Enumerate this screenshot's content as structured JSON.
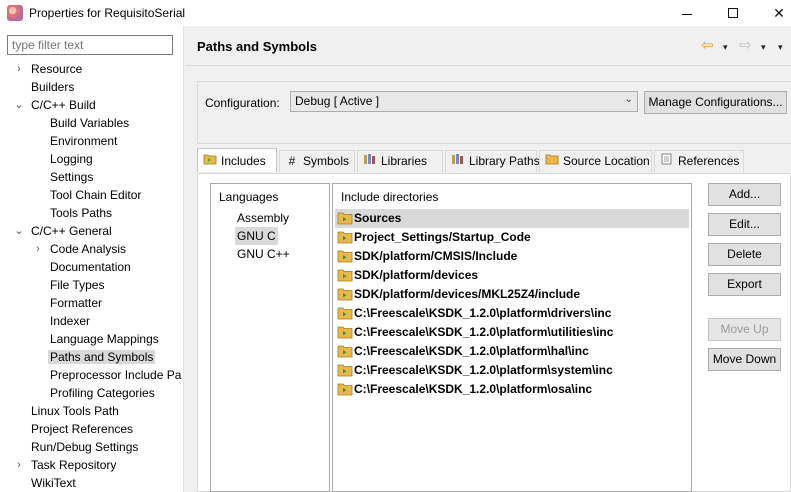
{
  "window": {
    "title": "Properties for RequisitoSerial",
    "minimize_label": "",
    "maximize_label": "",
    "close_label": "✕"
  },
  "filter": {
    "placeholder": "type filter text"
  },
  "tree": [
    {
      "label": "Resource",
      "expander": "›"
    },
    {
      "label": "Builders",
      "expander": ""
    },
    {
      "label": "C/C++ Build",
      "expander": "⌄"
    },
    {
      "label": "Build Variables",
      "expander": ""
    },
    {
      "label": "Environment",
      "expander": ""
    },
    {
      "label": "Logging",
      "expander": ""
    },
    {
      "label": "Settings",
      "expander": ""
    },
    {
      "label": "Tool Chain Editor",
      "expander": ""
    },
    {
      "label": "Tools Paths",
      "expander": ""
    },
    {
      "label": "C/C++ General",
      "expander": "⌄"
    },
    {
      "label": "Code Analysis",
      "expander": "›"
    },
    {
      "label": "Documentation",
      "expander": ""
    },
    {
      "label": "File Types",
      "expander": ""
    },
    {
      "label": "Formatter",
      "expander": ""
    },
    {
      "label": "Indexer",
      "expander": ""
    },
    {
      "label": "Language Mappings",
      "expander": ""
    },
    {
      "label": "Paths and Symbols",
      "expander": ""
    },
    {
      "label": "Preprocessor Include Pa",
      "expander": ""
    },
    {
      "label": "Profiling Categories",
      "expander": ""
    },
    {
      "label": "Linux Tools Path",
      "expander": ""
    },
    {
      "label": "Project References",
      "expander": ""
    },
    {
      "label": "Run/Debug Settings",
      "expander": ""
    },
    {
      "label": "Task Repository",
      "expander": "›"
    },
    {
      "label": "WikiText",
      "expander": ""
    }
  ],
  "page": {
    "title": "Paths and Symbols",
    "back_icon": "⇦",
    "forward_icon": "⇨",
    "dropdown_icon": "▾"
  },
  "configuration": {
    "label": "Configuration:",
    "value": "Debug  [ Active ]",
    "manage_label": "Manage Configurations..."
  },
  "tabs": [
    {
      "label": "Includes",
      "icon": "include-folder-icon"
    },
    {
      "label": "Symbols",
      "icon": "hash-icon"
    },
    {
      "label": "Libraries",
      "icon": "library-icon"
    },
    {
      "label": "Library Paths",
      "icon": "library-path-icon"
    },
    {
      "label": "Source Location",
      "icon": "source-folder-icon"
    },
    {
      "label": "References",
      "icon": "references-icon"
    }
  ],
  "languages": {
    "header": "Languages",
    "items": [
      "Assembly",
      "GNU C",
      "GNU C++"
    ]
  },
  "includes": {
    "header": "Include directories",
    "items": [
      "Sources",
      "Project_Settings/Startup_Code",
      "SDK/platform/CMSIS/Include",
      "SDK/platform/devices",
      "SDK/platform/devices/MKL25Z4/include",
      "C:\\Freescale\\KSDK_1.2.0\\platform\\drivers\\inc",
      "C:\\Freescale\\KSDK_1.2.0\\platform\\utilities\\inc",
      "C:\\Freescale\\KSDK_1.2.0\\platform\\hal\\inc",
      "C:\\Freescale\\KSDK_1.2.0\\platform\\system\\inc",
      "C:\\Freescale\\KSDK_1.2.0\\platform\\osa\\inc"
    ]
  },
  "buttons": {
    "add": "Add...",
    "edit": "Edit...",
    "delete": "Delete",
    "export": "Export",
    "move_up": "Move Up",
    "move_down": "Move Down"
  },
  "colors": {
    "selection": "#d9d9d9",
    "panel": "#f0f0f0",
    "folder": "#e8b84a"
  }
}
